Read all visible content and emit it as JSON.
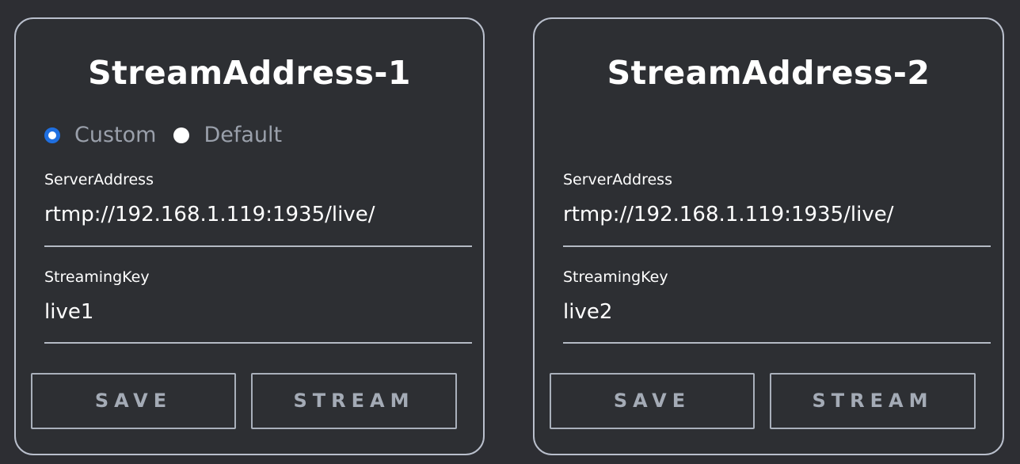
{
  "cards": [
    {
      "title": "StreamAddress-1",
      "radio": {
        "options": [
          "Custom",
          "Default"
        ],
        "selected": "Custom"
      },
      "server_address": {
        "label": "ServerAddress",
        "value": "rtmp://192.168.1.119:1935/live/"
      },
      "streaming_key": {
        "label": "StreamingKey",
        "value": "live1"
      },
      "buttons": {
        "save": "SAVE",
        "stream": "STREAM"
      }
    },
    {
      "title": "StreamAddress-2",
      "server_address": {
        "label": "ServerAddress",
        "value": "rtmp://192.168.1.119:1935/live/"
      },
      "streaming_key": {
        "label": "StreamingKey",
        "value": "live2"
      },
      "buttons": {
        "save": "SAVE",
        "stream": "STREAM"
      }
    }
  ],
  "colors": {
    "background": "#2d2e33",
    "border": "#b9bfcc",
    "radio_accent": "#1f6fe0",
    "muted_text": "#9aa0ab"
  }
}
